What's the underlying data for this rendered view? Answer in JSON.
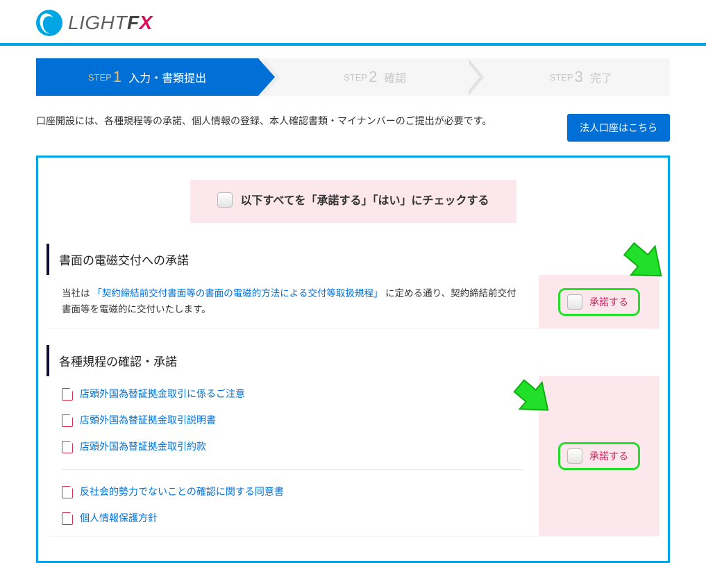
{
  "logo": {
    "text_a": "LIGHT",
    "text_b": "F",
    "text_c": "X"
  },
  "stepper": {
    "s1": {
      "num_label": "STEP",
      "num": "1",
      "title": "入力・書類提出"
    },
    "s2": {
      "num_label": "STEP",
      "num": "2",
      "title": "確認"
    },
    "s3": {
      "num_label": "STEP",
      "num": "3",
      "title": "完了"
    }
  },
  "intro": {
    "text": "口座開設には、各種規程等の承諾、個人情報の登録、本人確認書類・マイナンバーのご提出が必要です。",
    "corp_button": "法人口座はこちら"
  },
  "master_check": {
    "label": "以下すべてを「承諾する」「はい」にチェックする"
  },
  "section1": {
    "heading": "書面の電磁交付への承諾",
    "body_pre": "当社は",
    "body_link": "「契約締結前交付書面等の書面の電磁的方法による交付等取扱規程」",
    "body_post": "に定める通り、契約締結前交付書面等を電磁的に交付いたします。",
    "accept_label": "承諾する"
  },
  "section2": {
    "heading": "各種規程の確認・承諾",
    "docs_a": [
      "店頭外国為替証拠金取引に係るご注意",
      "店頭外国為替証拠金取引説明書",
      "店頭外国為替証拠金取引約款"
    ],
    "docs_b": [
      "反社会的勢力でないことの確認に関する同意書",
      "個人情報保護方針"
    ],
    "accept_label": "承諾する"
  }
}
